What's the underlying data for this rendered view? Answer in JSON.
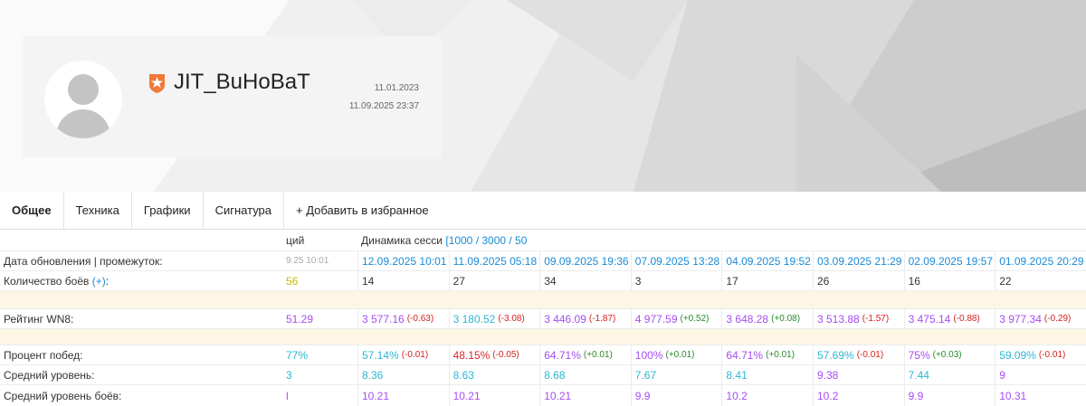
{
  "profile": {
    "nickname": "JIT_BuHoBaT",
    "date_created": "11.01.2023",
    "date_updated": "11.09.2025 23:37",
    "badge_color": "#f07a3a"
  },
  "tabs": [
    "Общее",
    "Техника",
    "Графики",
    "Сигнатура",
    "+ Добавить в избранное"
  ],
  "table": {
    "col0_header": "ций",
    "dynamics_label": "Динамика сесси",
    "dynamics_link": "[1000 / 3000 / 50",
    "dates": [
      "12.09.2025 10:01",
      "11.09.2025 05:18",
      "09.09.2025 19:36",
      "07.09.2025 13:28",
      "04.09.2025 19:52",
      "03.09.2025 21:29",
      "02.09.2025 19:57",
      "01.09.2025 20:29"
    ],
    "rows": {
      "updated": {
        "label": "Дата обновления | промежуток:",
        "col0": "9.25 10:01"
      },
      "battles": {
        "label": "Количество боёв",
        "plus": "(+)",
        "colon": ":",
        "col0": "56",
        "values": [
          "14",
          "27",
          "34",
          "3",
          "17",
          "26",
          "16",
          "22"
        ]
      },
      "wn8": {
        "label": "Рейтинг WN8:",
        "col0": "51.29",
        "values": [
          "3 577.16",
          "3 180.52",
          "3 446.09",
          "4 977.59",
          "3 648.28",
          "3 513.88",
          "3 475.14",
          "3 977.34"
        ],
        "deltas": [
          "(-0.63)",
          "(-3.08)",
          "(-1.87)",
          "(+0.52)",
          "(+0.08)",
          "(-1.57)",
          "(-0.88)",
          "(-0.29)"
        ]
      },
      "winrate": {
        "label": "Процент побед:",
        "col0": "77%",
        "values": [
          "57.14%",
          "48.15%",
          "64.71%",
          "100%",
          "64.71%",
          "57.69%",
          "75%",
          "59.09%"
        ],
        "deltas": [
          "(-0.01)",
          "(-0.05)",
          "(+0.01)",
          "(+0.01)",
          "(+0.01)",
          "(-0.01)",
          "(+0.03)",
          "(-0.01)"
        ]
      },
      "avg_tier": {
        "label": "Средний уровень:",
        "col0": "3",
        "values": [
          "8.36",
          "8.63",
          "8.68",
          "7.67",
          "8.41",
          "9.38",
          "7.44",
          "9"
        ]
      },
      "avg_battle_tier": {
        "label": "Средний уровень боёв:",
        "col0": "l",
        "values": [
          "10.21",
          "10.21",
          "10.21",
          "9.9",
          "10.2",
          "10.2",
          "9.9",
          "10.31"
        ]
      }
    }
  }
}
